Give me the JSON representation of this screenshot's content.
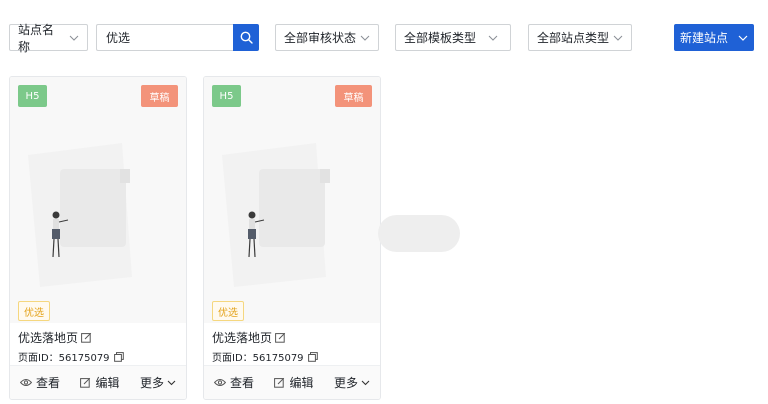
{
  "toolbar": {
    "site_name_select": "站点名称",
    "search_value": "优选",
    "review_status_select": "全部审核状态",
    "template_type_select": "全部模板类型",
    "site_type_select": "全部站点类型",
    "new_site_button": "新建站点"
  },
  "cards": [
    {
      "type_badge": "H5",
      "status_badge": "草稿",
      "tag": "优选",
      "title": "优选落地页",
      "page_id": "页面ID：56175079",
      "actions": {
        "view": "查看",
        "edit": "编辑",
        "more": "更多"
      }
    },
    {
      "type_badge": "H5",
      "status_badge": "草稿",
      "tag": "优选",
      "title": "优选落地页",
      "page_id": "页面ID：56175079",
      "actions": {
        "view": "查看",
        "edit": "编辑",
        "more": "更多"
      }
    }
  ],
  "colors": {
    "primary": "#1f61d6",
    "h5_badge": "#7cc98a",
    "draft_badge": "#f3937a",
    "tag_text": "#e3a21a"
  }
}
